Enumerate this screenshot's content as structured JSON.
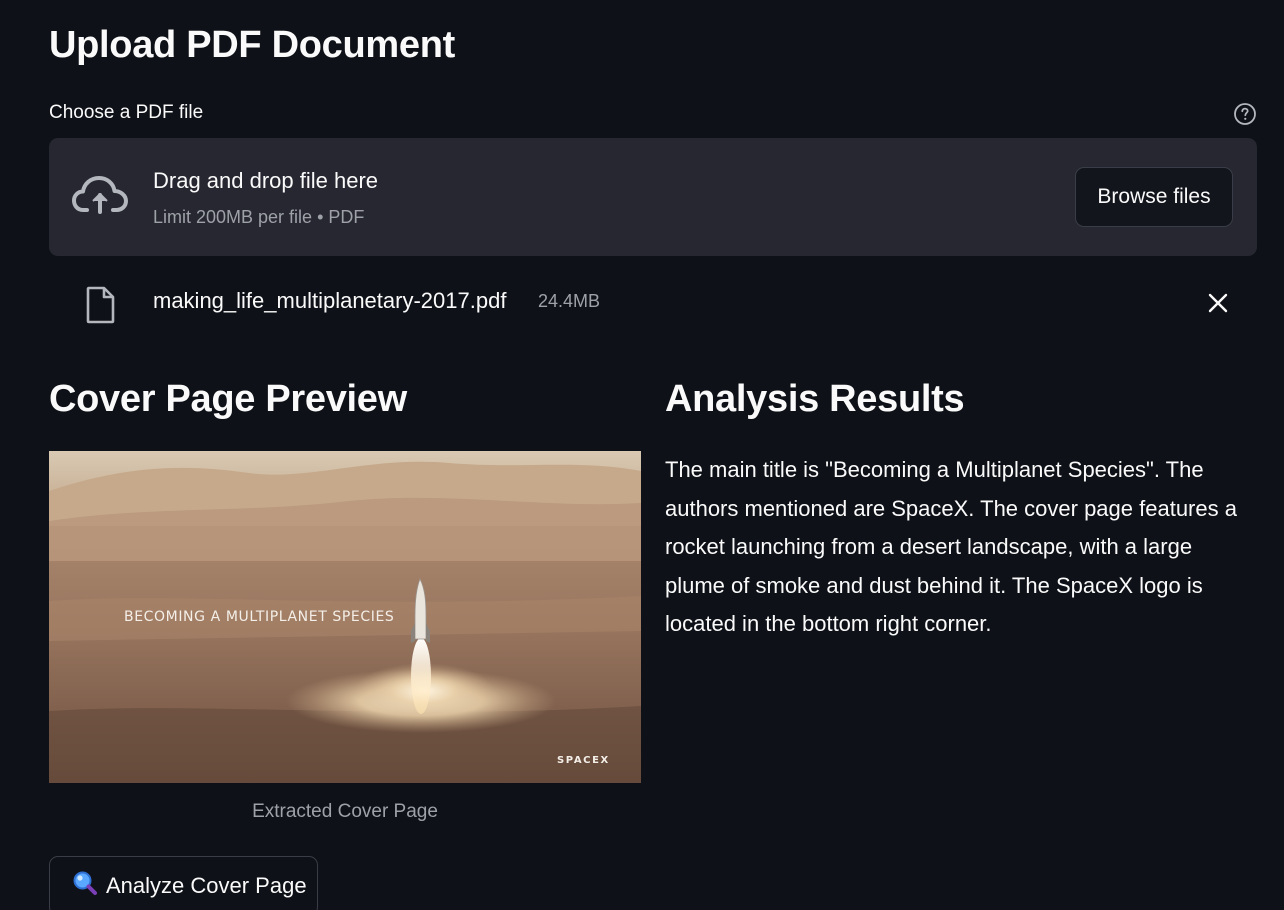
{
  "page": {
    "title": "Upload PDF Document"
  },
  "uploader": {
    "label": "Choose a PDF file",
    "drop_text": "Drag and drop file here",
    "limit_text": "Limit 200MB per file • PDF",
    "browse_label": "Browse files",
    "icons": [
      "cloud-upload-icon",
      "help-icon"
    ]
  },
  "uploaded_file": {
    "name": "making_life_multiplanetary-2017.pdf",
    "size": "24.4MB",
    "icons": [
      "file-icon",
      "close-icon"
    ]
  },
  "cover_section": {
    "title": "Cover Page Preview",
    "image_caption": "Extracted Cover Page",
    "image_text": "BECOMING A MULTIPLANET SPECIES",
    "image_logo": "SPACEX",
    "analyze_label": "Analyze Cover Page",
    "analyze_icon": "magnifying-glass-icon"
  },
  "results_section": {
    "title": "Analysis Results",
    "text": "The main title is \"Becoming a Multiplanet Species\". The authors mentioned are SpaceX. The cover page features a rocket launching from a desert landscape, with a large plume of smoke and dust behind it. The SpaceX logo is located in the bottom right corner."
  },
  "colors": {
    "background": "#0e1117",
    "panel": "#262730",
    "text": "#fafafa",
    "muted": "#9ea1a8",
    "border": "#3a3d47"
  }
}
